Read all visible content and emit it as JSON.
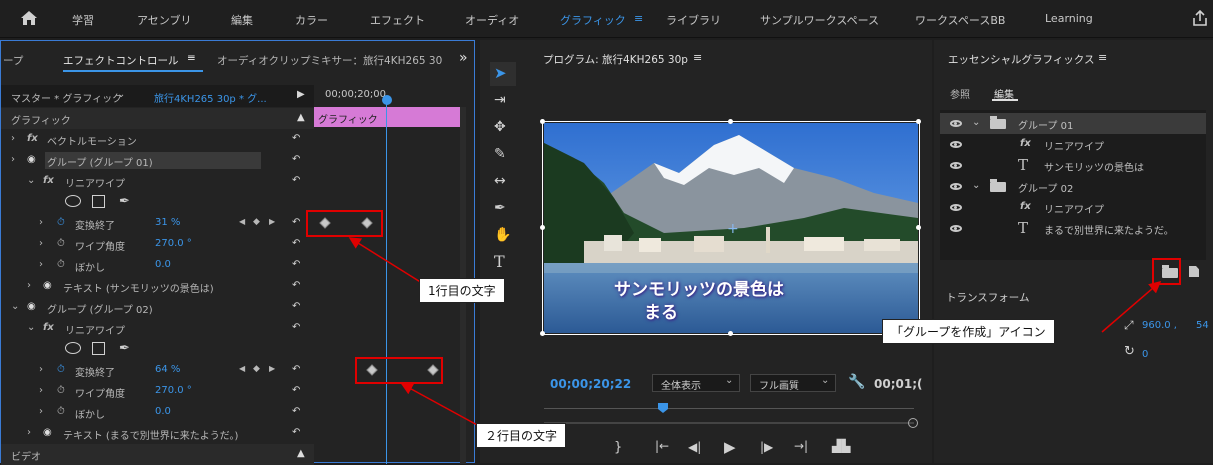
{
  "topbar": {
    "home_icon": "home-icon",
    "workspaces": [
      "学習",
      "アセンブリ",
      "編集",
      "カラー",
      "エフェクト",
      "オーディオ",
      "グラフィック",
      "ライブラリ",
      "サンプルワークスペース",
      "ワークスペースBB",
      "Learning"
    ],
    "active_workspace": "グラフィック",
    "menu_icon": "≡",
    "share_icon": "share-icon"
  },
  "left_panel": {
    "tab_partial": "ープ",
    "tab_effect_controls": "エフェクトコントロール",
    "tab_menu": "≡",
    "tab_audio_mixer": "オーディオクリップミキサー：旅行4KH265 30",
    "overflow": "»",
    "master_label": "マスター * グラフィック",
    "clip_label": "旅行4KH265 30p * グ...",
    "timecode": "00;00;20;00",
    "graphic_clip_label": "グラフィック",
    "section_graphic": "グラフィック",
    "rows": [
      {
        "label": "ベクトルモーション"
      },
      {
        "label": "グループ (グループ 01)"
      },
      {
        "label": "リニアワイプ"
      },
      {
        "label": "変換終了",
        "value": "31 %"
      },
      {
        "label": "ワイプ角度",
        "value": "270.0 °"
      },
      {
        "label": "ぼかし",
        "value": "0.0"
      },
      {
        "label": "テキスト (サンモリッツの景色は)"
      },
      {
        "label": "グループ (グループ 02)"
      },
      {
        "label": "リニアワイプ"
      },
      {
        "label": "変換終了",
        "value": "64 %"
      },
      {
        "label": "ワイプ角度",
        "value": "270.0 °"
      },
      {
        "label": "ぼかし",
        "value": "0.0"
      },
      {
        "label": "テキスト (まるで別世界に来たようだ。)"
      }
    ],
    "section_video": "ビデオ"
  },
  "program": {
    "title": "プログラム: 旅行4KH265 30p",
    "menu": "≡",
    "overlay_line1": "サンモリッツの景色は",
    "overlay_line2": "まる",
    "timecode": "00;00;20;22",
    "zoom_select": "全体表示",
    "quality_select": "フル画質",
    "duration": "00;01;("
  },
  "essential_graphics": {
    "title": "エッセンシャルグラフィックス",
    "menu": "≡",
    "tab_browse": "参照",
    "tab_edit": "編集",
    "layers": [
      {
        "label": "グループ 01"
      },
      {
        "label": "リニアワイプ"
      },
      {
        "label": "サンモリッツの景色は"
      },
      {
        "label": "グループ 02"
      },
      {
        "label": "リニアワイプ"
      },
      {
        "label": "まるで別世界に来たようだ。"
      }
    ],
    "transform_label": "トランスフォーム",
    "position_value": "960.0 ,",
    "position_value2": "54",
    "rotation_value": "0"
  },
  "annotations": {
    "callout1": "1行目の文字",
    "callout2": "２行目の文字",
    "callout3": "「グループを作成」アイコン"
  },
  "colors": {
    "accent": "#3b95e8",
    "annotation_red": "#e00000",
    "clip_pink": "#d67ad6"
  }
}
